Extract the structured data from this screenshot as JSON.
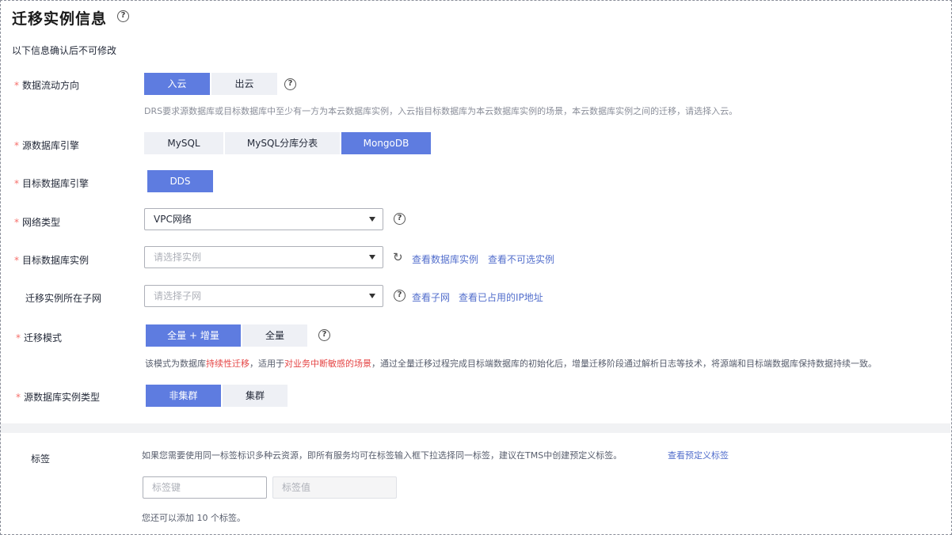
{
  "page": {
    "title": "迁移实例信息",
    "subtitle": "以下信息确认后不可修改"
  },
  "colors": {
    "accent": "#5e7ce0",
    "segment_bg": "#eef0f5",
    "required_star": "#f66f6a",
    "link": "#526ecc",
    "warning_red": "#e54545"
  },
  "required_mark": "*",
  "flow_direction": {
    "label": "数据流动方向",
    "options": [
      "入云",
      "出云"
    ],
    "selected": "入云",
    "hint": "DRS要求源数据库或目标数据库中至少有一方为本云数据库实例，入云指目标数据库为本云数据库实例的场景，本云数据库实例之间的迁移，请选择入云。"
  },
  "source_engine": {
    "label": "源数据库引擎",
    "options": [
      "MySQL",
      "MySQL分库分表",
      "MongoDB"
    ],
    "selected": "MongoDB"
  },
  "target_engine": {
    "label": "目标数据库引擎",
    "options": [
      "DDS"
    ],
    "selected": "DDS"
  },
  "network_type": {
    "label": "网络类型",
    "value": "VPC网络"
  },
  "target_instance": {
    "label": "目标数据库实例",
    "placeholder": "请选择实例",
    "link_view_instances": "查看数据库实例",
    "link_view_unavailable": "查看不可选实例"
  },
  "subnet": {
    "label": "迁移实例所在子网",
    "placeholder": "请选择子网",
    "link_view_subnet": "查看子网",
    "link_view_used_ip": "查看已占用的IP地址"
  },
  "migration_mode": {
    "label": "迁移模式",
    "options": [
      "全量 + 增量",
      "全量"
    ],
    "selected": "全量 + 增量",
    "hint_parts": {
      "p1": "该模式为数据库",
      "p2": "持续性迁移",
      "p3": "，适用于",
      "p4": "对业务中断敏感的场景",
      "p5": "，通过全量迁移过程完成目标端数据库的初始化后，增量迁移阶段通过解析日志等技术，将源端和目标端数据库保持数据持续一致。"
    }
  },
  "source_instance_type": {
    "label": "源数据库实例类型",
    "options": [
      "非集群",
      "集群"
    ],
    "selected": "非集群"
  },
  "tags": {
    "label": "标签",
    "hint": "如果您需要使用同一标签标识多种云资源，即所有服务均可在标签输入框下拉选择同一标签，建议在TMS中创建预定义标签。",
    "link_predefined": "查看预定义标签",
    "key_placeholder": "标签键",
    "value_placeholder": "标签值",
    "remaining": "您还可以添加 10 个标签。"
  },
  "icons": {
    "help": "question-circle-icon",
    "refresh": "refresh-icon",
    "caret": "caret-down-icon"
  }
}
